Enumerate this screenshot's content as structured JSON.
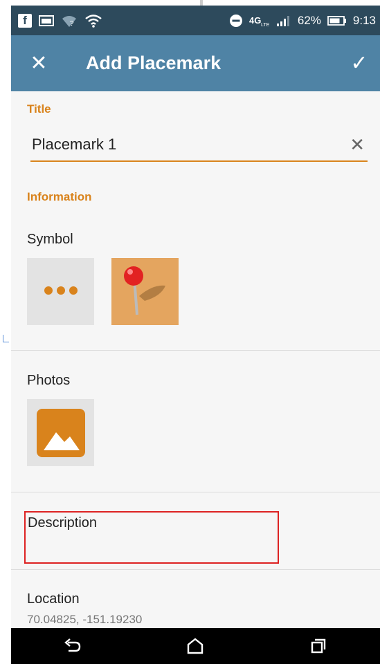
{
  "status_bar": {
    "battery": "62%",
    "time": "9:13",
    "icons": [
      "facebook-icon",
      "image-icon",
      "wifi-question-icon",
      "wifi-icon",
      "dnd-icon",
      "4g-lte-icon",
      "signal-icon",
      "battery-icon"
    ]
  },
  "app_bar": {
    "title": "Add Placemark",
    "close_icon": "close-icon",
    "confirm_icon": "check-icon"
  },
  "title_section": {
    "label": "Title",
    "value": "Placemark 1"
  },
  "information": {
    "label": "Information",
    "symbol_label": "Symbol",
    "photos_label": "Photos",
    "description_label": "Description",
    "location_label": "Location",
    "location_value": "70.04825, -151.19230"
  },
  "colors": {
    "app_bar": "#4f83a5",
    "status_bar": "#2d4a5c",
    "accent": "#d9831c",
    "highlight_border": "#dd2222"
  },
  "nav_bar": {
    "icons": [
      "back-icon",
      "home-icon",
      "recents-icon"
    ]
  }
}
